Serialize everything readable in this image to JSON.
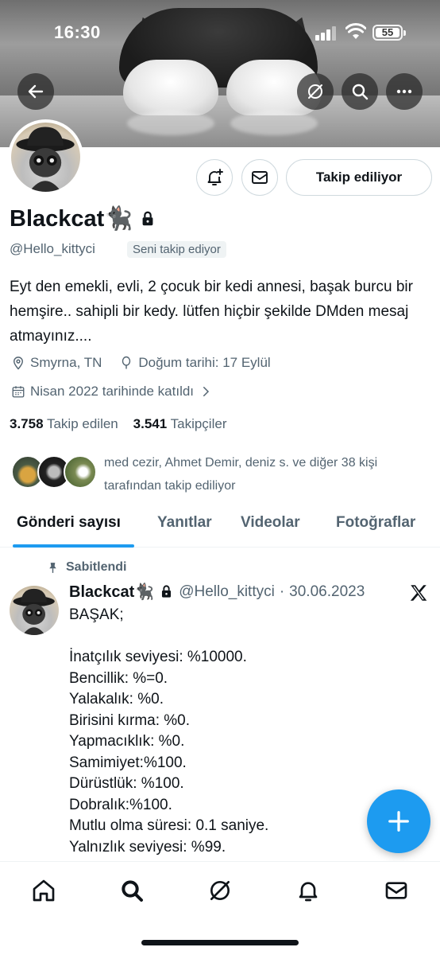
{
  "status_bar": {
    "time": "16:30",
    "battery": "55"
  },
  "profile": {
    "display_name": "Blackcat🐈‍⬛",
    "handle": "@Hello_kittyci",
    "follows_you_badge": "Seni takip ediyor",
    "follow_button_label": "Takip ediliyor",
    "bio": "Eyt den emekli, evli, 2 çocuk bir kedi annesi, başak burcu bir hemşire.. sahipli bir kedy. lütfen hiçbir şekilde DMden mesaj atmayınız....",
    "location": "Smyrna, TN",
    "birthday": "Doğum tarihi: 17 Eylül",
    "joined": "Nisan 2022 tarihinde katıldı",
    "following_count": "3.758",
    "following_label": "Takip edilen",
    "followers_count": "3.541",
    "followers_label": "Takipçiler",
    "mutual_followers_text": "med cezir, Ahmet Demir, deniz s. ve diğer 38 kişi tarafından takip ediliyor"
  },
  "tabs": [
    {
      "label": "Gönderi sayısı",
      "active": true
    },
    {
      "label": "Yanıtlar",
      "active": false
    },
    {
      "label": "Videolar",
      "active": false
    },
    {
      "label": "Fotoğraflar",
      "active": false
    }
  ],
  "pinned_post": {
    "pinned_label": "Sabitlendi",
    "author_name": "Blackcat🐈‍⬛",
    "author_handle": "@Hello_kittyci",
    "separator": "·",
    "date": "30.06.2023",
    "lines": [
      "BAŞAK;",
      "",
      "İnatçılık seviyesi: %10000.",
      "Bencillik: %=0.",
      "Yalakalık: %0.",
      "Birisini kırma: %0.",
      "Yapmacıklık: %0.",
      "Samimiyet:%100.",
      "Dürüstlük: %100.",
      "Dobralık:%100.",
      "Mutlu olma süresi: 0.1 saniye.",
      "Yalnızlık seviyesi: %99."
    ]
  },
  "icons": {
    "back": "back-arrow-icon",
    "grok": "grok-icon",
    "search": "search-icon",
    "more": "more-icon",
    "notify": "bell-plus-icon",
    "message": "envelope-icon",
    "lock": "lock-icon",
    "location": "location-pin-icon",
    "birthday": "balloon-icon",
    "calendar": "calendar-icon"
  },
  "colors": {
    "accent": "#1d9bf0",
    "text_primary": "#0f1419",
    "text_secondary": "#536471"
  }
}
